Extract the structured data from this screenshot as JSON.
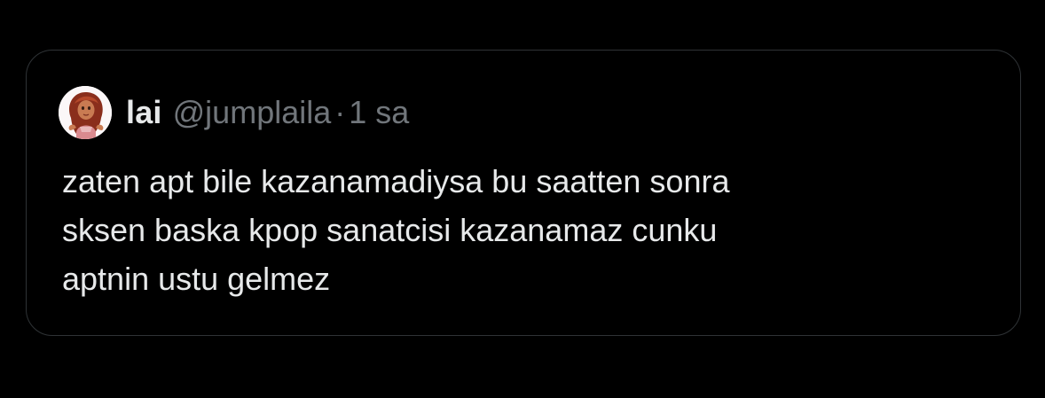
{
  "quoted_tweet": {
    "author": {
      "display_name": "lai",
      "handle": "@jumplaila",
      "avatar_icon": "avatar-cartoon-girl"
    },
    "separator": "·",
    "time": "1 sa",
    "text_lines": [
      "zaten apt bile kazanamadiysa bu saatten sonra",
      "sksen baska kpop sanatcisi kazanamaz cunku",
      "aptnin ustu gelmez"
    ]
  },
  "colors": {
    "background": "#000000",
    "card_border": "#2f3336",
    "primary_text": "#e7e9ea",
    "secondary_text": "#71767b"
  }
}
